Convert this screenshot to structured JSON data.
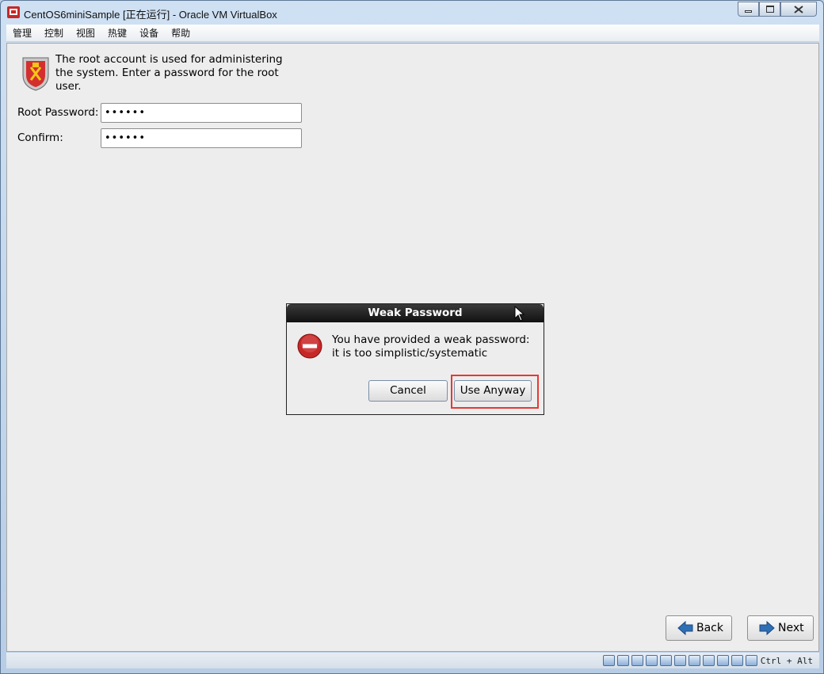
{
  "window": {
    "title": "CentOS6miniSample [正在运行] - Oracle VM VirtualBox"
  },
  "menubar": {
    "items": [
      "管理",
      "控制",
      "视图",
      "热键",
      "设备",
      "帮助"
    ]
  },
  "installer": {
    "info_text": "The root account is used for administering the system.  Enter a password for the root user.",
    "root_password_label": "Root Password:",
    "root_password_value": "••••••",
    "confirm_label": "Confirm:",
    "confirm_value": "••••••",
    "back_label": "Back",
    "next_label": "Next"
  },
  "dialog": {
    "title": "Weak Password",
    "message": "You have provided a weak password: it is too simplistic/systematic",
    "cancel_label": "Cancel",
    "use_anyway_label": "Use Anyway"
  },
  "statusbar": {
    "icons": [
      "hard-disk-icon",
      "optical-drive-icon",
      "audio-icon",
      "network-icon",
      "usb-icon",
      "shared-folder-icon",
      "display-icon",
      "video-capture-icon",
      "cpu-icon",
      "mouse-integration-icon",
      "host-key-icon"
    ],
    "host_key": "Ctrl + Alt"
  },
  "colors": {
    "highlight": "#e53935",
    "dialog_title_bg": "#1a1a1a"
  }
}
